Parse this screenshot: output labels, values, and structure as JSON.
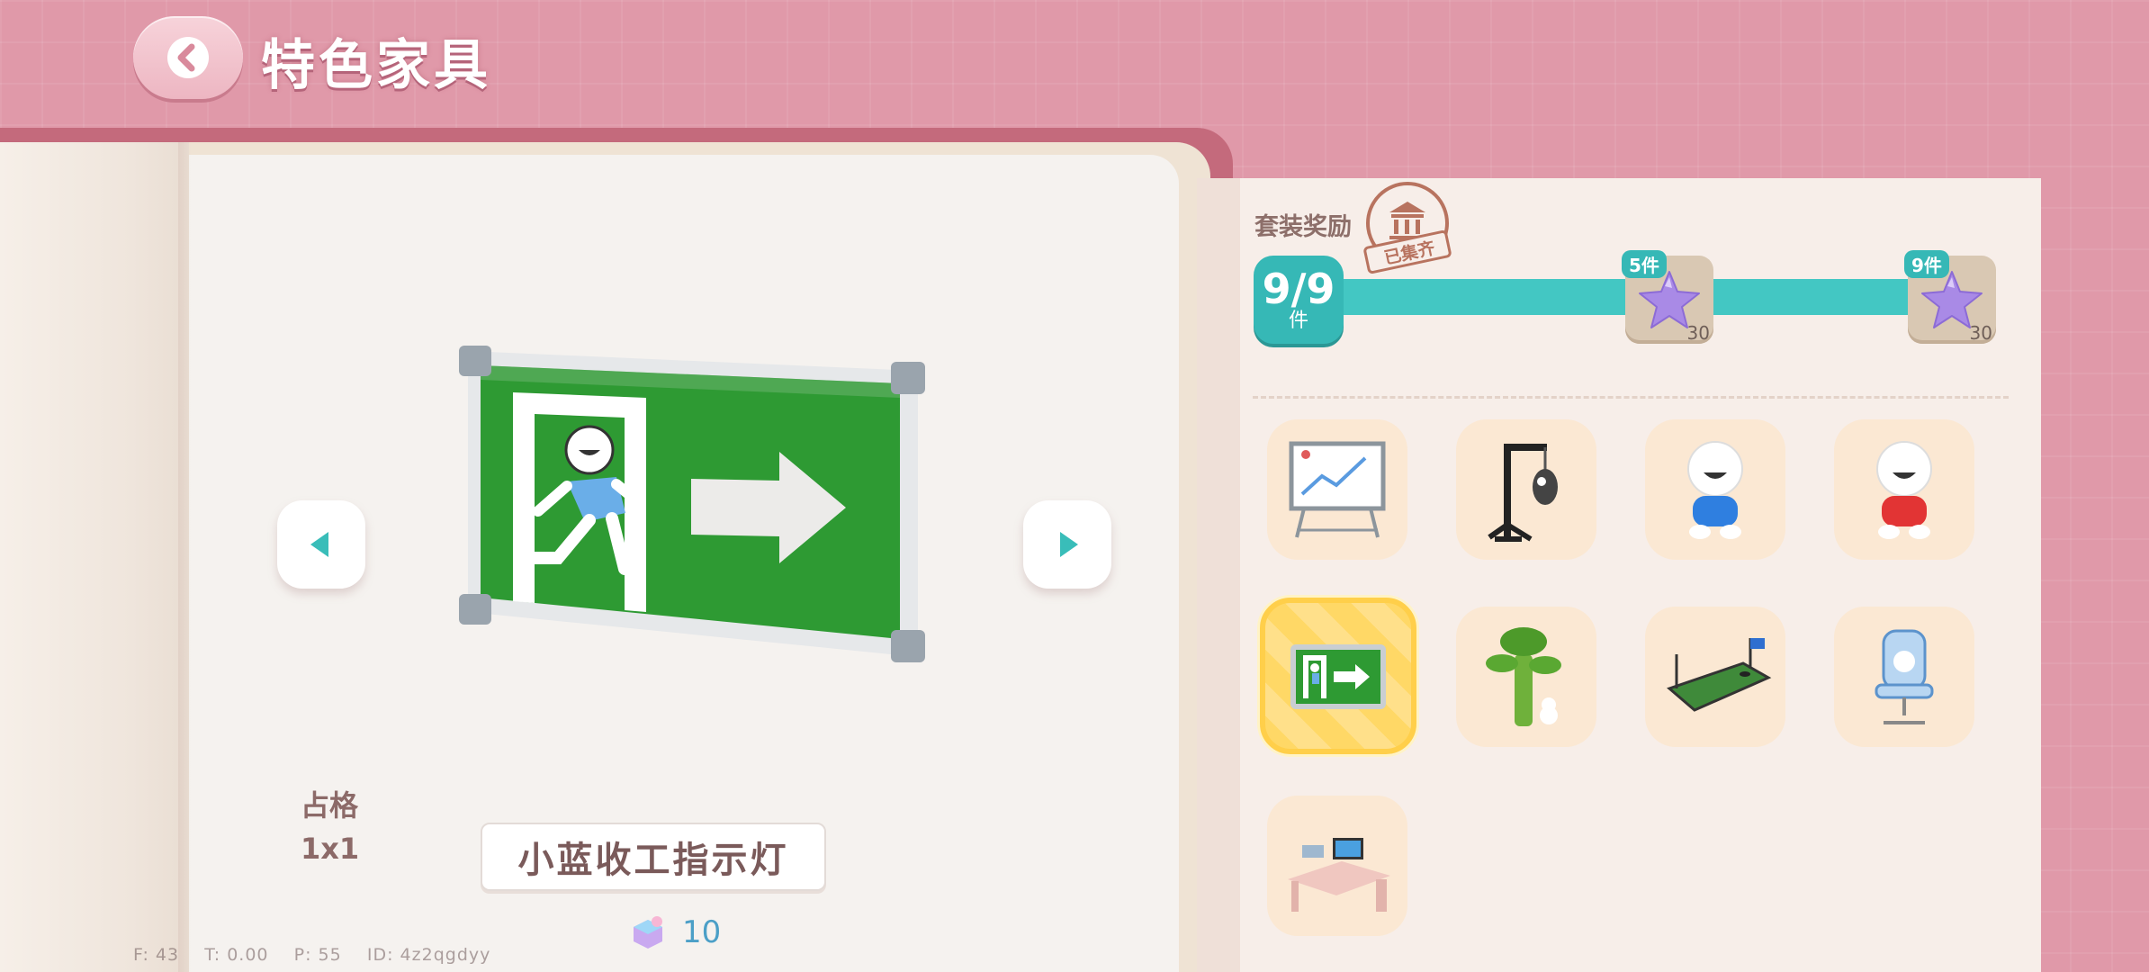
{
  "header": {
    "title": "特色家具",
    "back_icon": "chevron-left-icon"
  },
  "detail": {
    "grid_label": "占格",
    "grid_value": "1x1",
    "item_name": "小蓝收工指示灯",
    "cost_value": "10",
    "cost_icon": "puzzle-piece-icon",
    "debug": "F: 43    T: 0.00    P: 55    ID: 4z2qgdyy"
  },
  "set_reward": {
    "title": "套装奖励",
    "stamp_text": "已集齐",
    "progress_num": "9/9",
    "progress_unit": "件",
    "progress": 1.0,
    "rewards": [
      {
        "badge": "5件",
        "amount": "30",
        "icon": "purple-star-icon"
      },
      {
        "badge": "9件",
        "amount": "30",
        "icon": "purple-star-icon"
      }
    ]
  },
  "items": [
    {
      "name": "whiteboard",
      "icon": "whiteboard-icon"
    },
    {
      "name": "punching-bag-stand",
      "icon": "punching-bag-icon"
    },
    {
      "name": "blue-doll",
      "icon": "blue-doll-icon"
    },
    {
      "name": "red-doll",
      "icon": "red-doll-icon"
    },
    {
      "name": "exit-sign",
      "icon": "exit-sign-icon",
      "selected": true
    },
    {
      "name": "money-plant",
      "icon": "plant-icon"
    },
    {
      "name": "golf-mat",
      "icon": "golf-mat-icon"
    },
    {
      "name": "gaming-chair",
      "icon": "gaming-chair-icon"
    },
    {
      "name": "computer-desk",
      "icon": "computer-desk-icon"
    }
  ],
  "colors": {
    "accent": "#36b8b6",
    "background": "#e099a9",
    "selected": "#ffcf4a"
  }
}
